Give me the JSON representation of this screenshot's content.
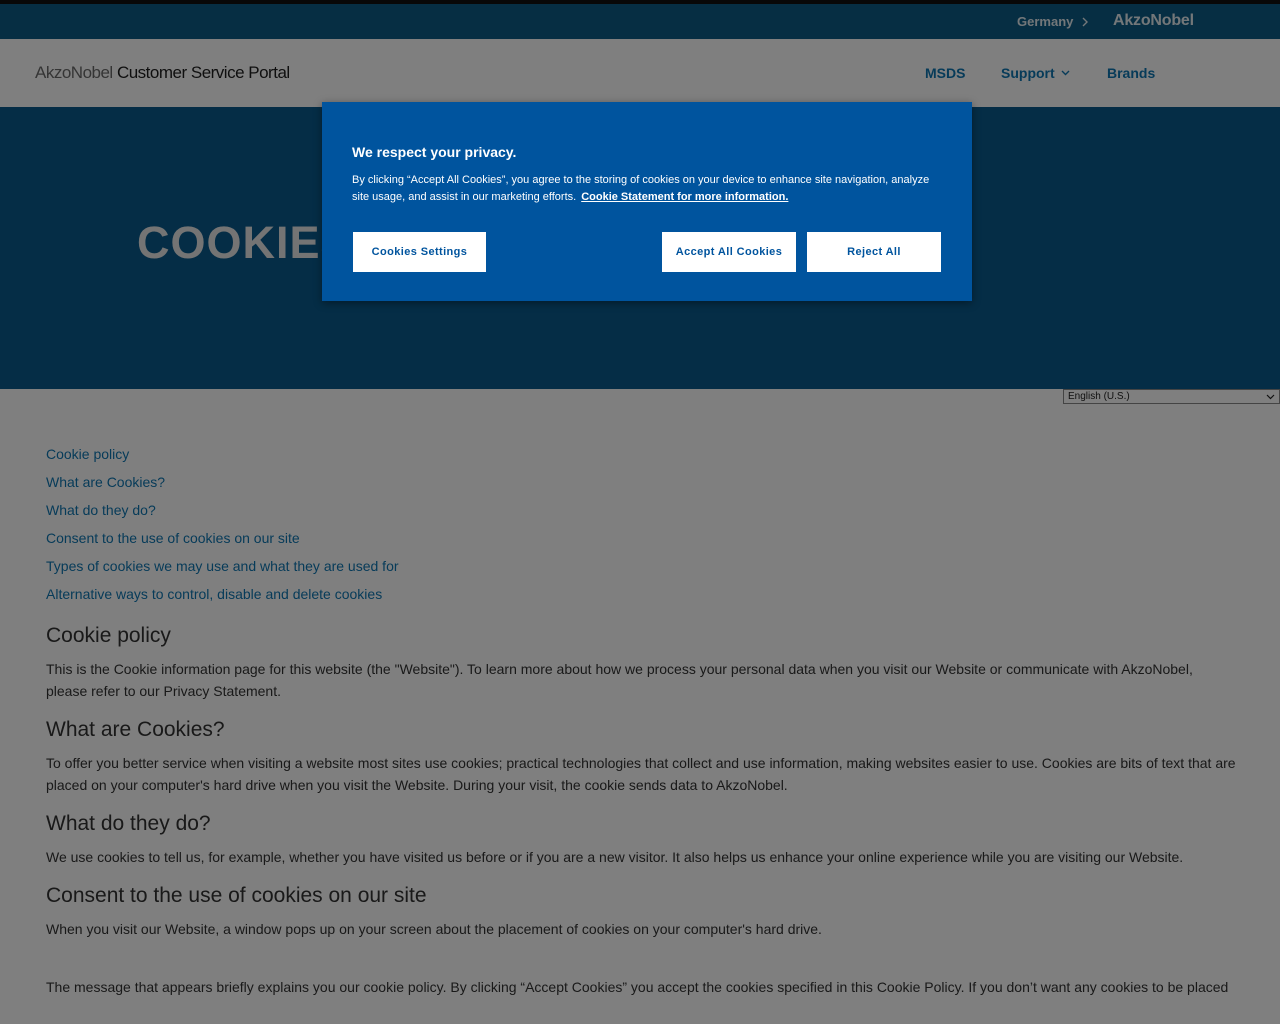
{
  "topbar": {
    "country": "Germany",
    "brand": "AkzoNobel"
  },
  "header": {
    "logo_part1": "AkzoNobel",
    "logo_part2": " Customer Service Portal",
    "nav": {
      "msds": "MSDS",
      "support": "Support",
      "brands": "Brands"
    }
  },
  "hero": {
    "title": "COOKIES"
  },
  "language": {
    "selected": "English (U.S.)"
  },
  "toc": [
    "Cookie policy",
    "What are Cookies?",
    "What do they do?",
    "Consent to the use of cookies on our site",
    "Types of cookies we may use and what they are used for",
    "Alternative ways to control, disable and delete cookies"
  ],
  "sections": {
    "cookie_policy": {
      "heading": "Cookie policy",
      "text": "This is the Cookie information page for this website (the \"Website\"). To learn more about how we process your personal data when you visit our Website or communicate with AkzoNobel, please refer to our Privacy Statement."
    },
    "what_are": {
      "heading": "What are Cookies?",
      "text": "To offer you better service when visiting a website most sites use cookies; practical technologies that collect and use information, making websites easier to use. Cookies are bits of text that are placed on your computer's hard drive when you visit the Website. During your visit, the cookie sends data to AkzoNobel."
    },
    "what_do": {
      "heading": "What do they do?",
      "text": "We use cookies to tell us, for example, whether you have visited us before or if you are a new visitor. It also helps us enhance your online experience while you are visiting our Website."
    },
    "consent": {
      "heading": "Consent to the use of cookies on our site",
      "text1": "When you visit our Website, a window pops up on your screen about the placement of cookies on your computer's hard drive.",
      "text2": "The message that appears briefly explains you our cookie policy. By clicking “Accept Cookies” you accept the cookies specified in this Cookie Policy. If you don’t want any cookies to be placed"
    }
  },
  "cookie_banner": {
    "title": "We respect your privacy.",
    "text": "By clicking “Accept All Cookies”, you agree to the storing of cookies on your device to enhance site navigation, analyze site usage, and assist in our marketing efforts.",
    "link": "Cookie Statement for more information.",
    "settings_button": "Cookies Settings",
    "accept_button": "Accept All Cookies",
    "reject_button": "Reject All"
  },
  "colors": {
    "topbar": "#0c5d86",
    "hero": "#0a5b8c",
    "modal": "#00549e",
    "link": "#0e77b3"
  }
}
